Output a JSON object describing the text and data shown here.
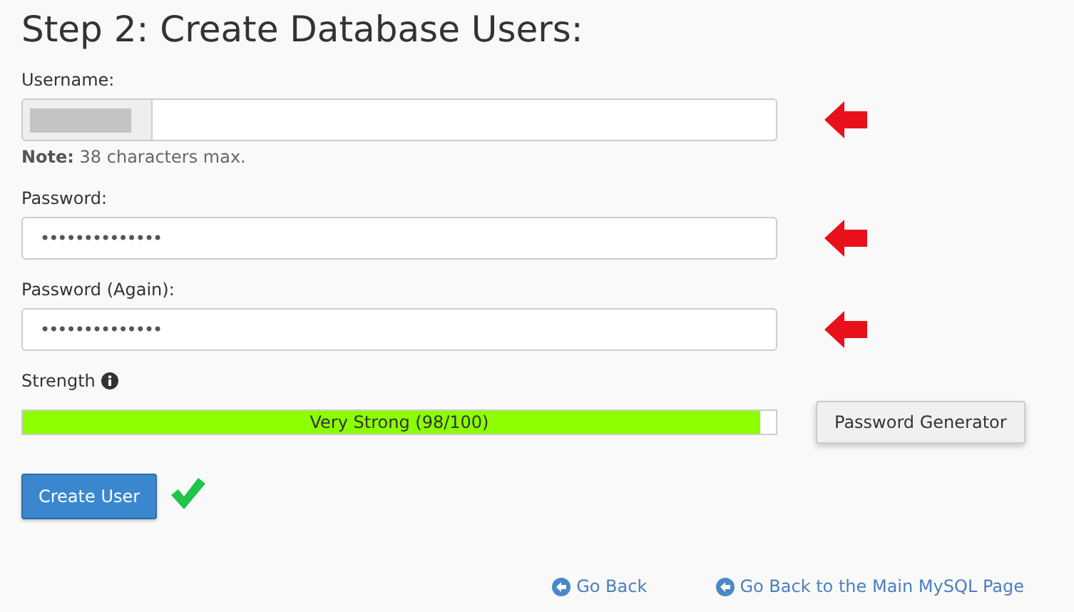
{
  "title": "Step 2: Create Database Users:",
  "fields": [
    {
      "kind": "prefixed",
      "label": "Username:",
      "arrow": true,
      "note_label": "Note:",
      "note": "38 characters max."
    },
    {
      "kind": "plain",
      "label": "Password:",
      "value": "••••••••••••••",
      "arrow": true
    },
    {
      "kind": "plain",
      "label": "Password (Again):",
      "value": "••••••••••••••",
      "arrow": true
    }
  ],
  "strength": {
    "label": "Strength",
    "level": 0.98,
    "reading": "Very Strong (98/100)",
    "generator_button": "Password Generator"
  },
  "submit": {
    "label": "Create User",
    "confirmed": true
  },
  "links": [
    "Go Back",
    "Go Back to the Main MySQL Page"
  ]
}
